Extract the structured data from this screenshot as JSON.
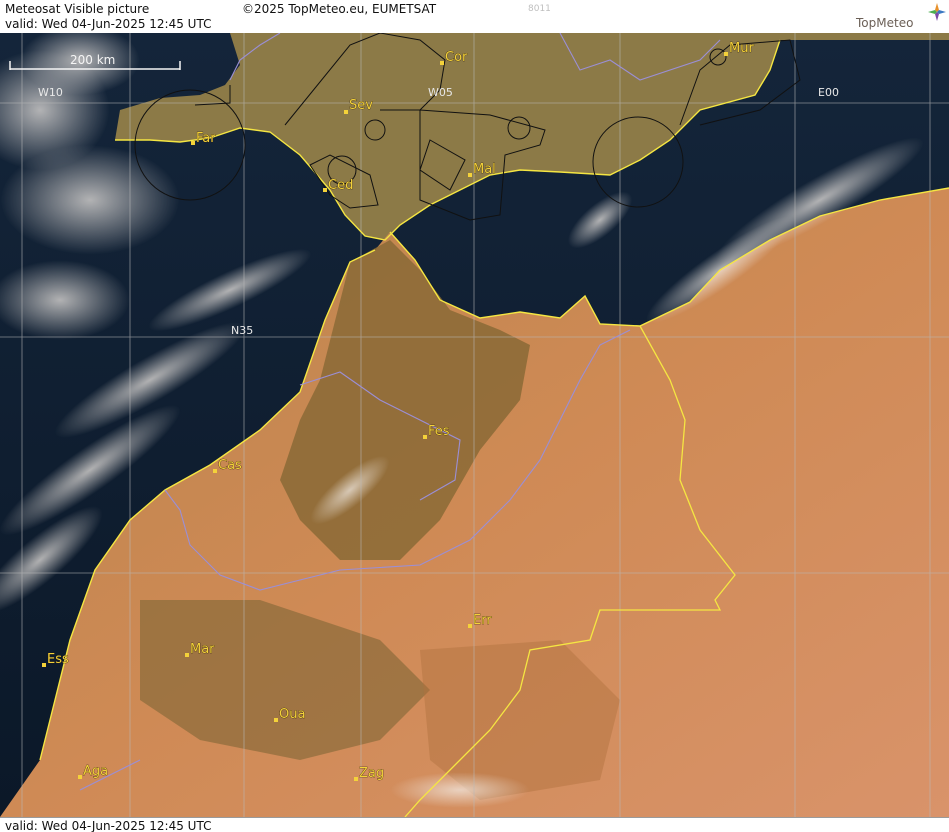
{
  "header": {
    "title": "Meteosat Visible picture",
    "valid": "valid:  Wed  04-Jun-2025  12:45 UTC",
    "copyright": "©2025 TopMeteo.eu, EUMETSAT",
    "code": "8011",
    "logo_text": "TopMeteo"
  },
  "footer": {
    "valid": "valid:  Wed  04-Jun-2025  12:45 UTC"
  },
  "map": {
    "scale_label": "200 km",
    "grid_labels": {
      "w10": "W10",
      "w05": "W05",
      "e00": "E00",
      "n35": "N35"
    },
    "cities": {
      "cor": "Cor",
      "mur": "Mur",
      "sev": "Sev",
      "far": "Far",
      "ced": "Ced",
      "mal": "Mal",
      "fes": "Fes",
      "cas": "Cas",
      "err": "Err",
      "ess": "Ess",
      "mar": "Mar",
      "oua": "Oua",
      "aga": "Aga",
      "zag": "Zag"
    },
    "colors": {
      "coastline": "#f5e642",
      "border": "#9b8fd6",
      "grid": "#b9b9b9",
      "airspace": "#111111",
      "sea": "#0f1f33",
      "desert": "#c98552",
      "vegetation": "#8a6d3a",
      "city": "#f4d23a"
    }
  }
}
